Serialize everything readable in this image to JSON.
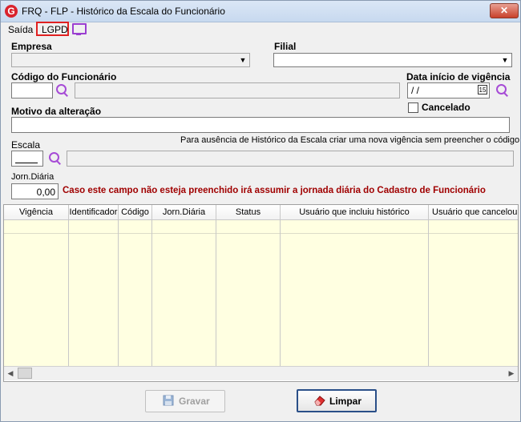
{
  "window": {
    "title": "FRQ - FLP - Histórico da Escala do Funcionário",
    "close_label": "✕",
    "app_icon": "G"
  },
  "menu": {
    "saida": "Saída",
    "lgpd": "LGPD",
    "monitor_icon": "monitor-icon"
  },
  "form": {
    "empresa_label": "Empresa",
    "filial_label": "Filial",
    "codigo_label": "Código do Funcionário",
    "data_label": "Data início de vigência",
    "data_value": " / /",
    "cal_label": "15",
    "cancelado_label": "Cancelado",
    "motivo_label": "Motivo da alteração",
    "escala_label": "Escala",
    "escala_hint": "Para ausência de Histórico da Escala criar uma nova vigência sem preencher o código",
    "jorn_label": "Jorn.Diária",
    "jorn_value": "0,00",
    "jorn_warning": "Caso este campo não esteja preenchido irá assumir a jornada diária do Cadastro de Funcionário"
  },
  "grid": {
    "columns": [
      "Vigência",
      "Identificador",
      "Código",
      "Jorn.Diária",
      "Status",
      "Usuário que incluiu histórico",
      "Usuário que cancelou h"
    ]
  },
  "buttons": {
    "gravar": "Gravar",
    "limpar": "Limpar"
  },
  "colors": {
    "warning": "#a00000",
    "accent": "#a64bd6",
    "grid_bg": "#ffffe1"
  }
}
